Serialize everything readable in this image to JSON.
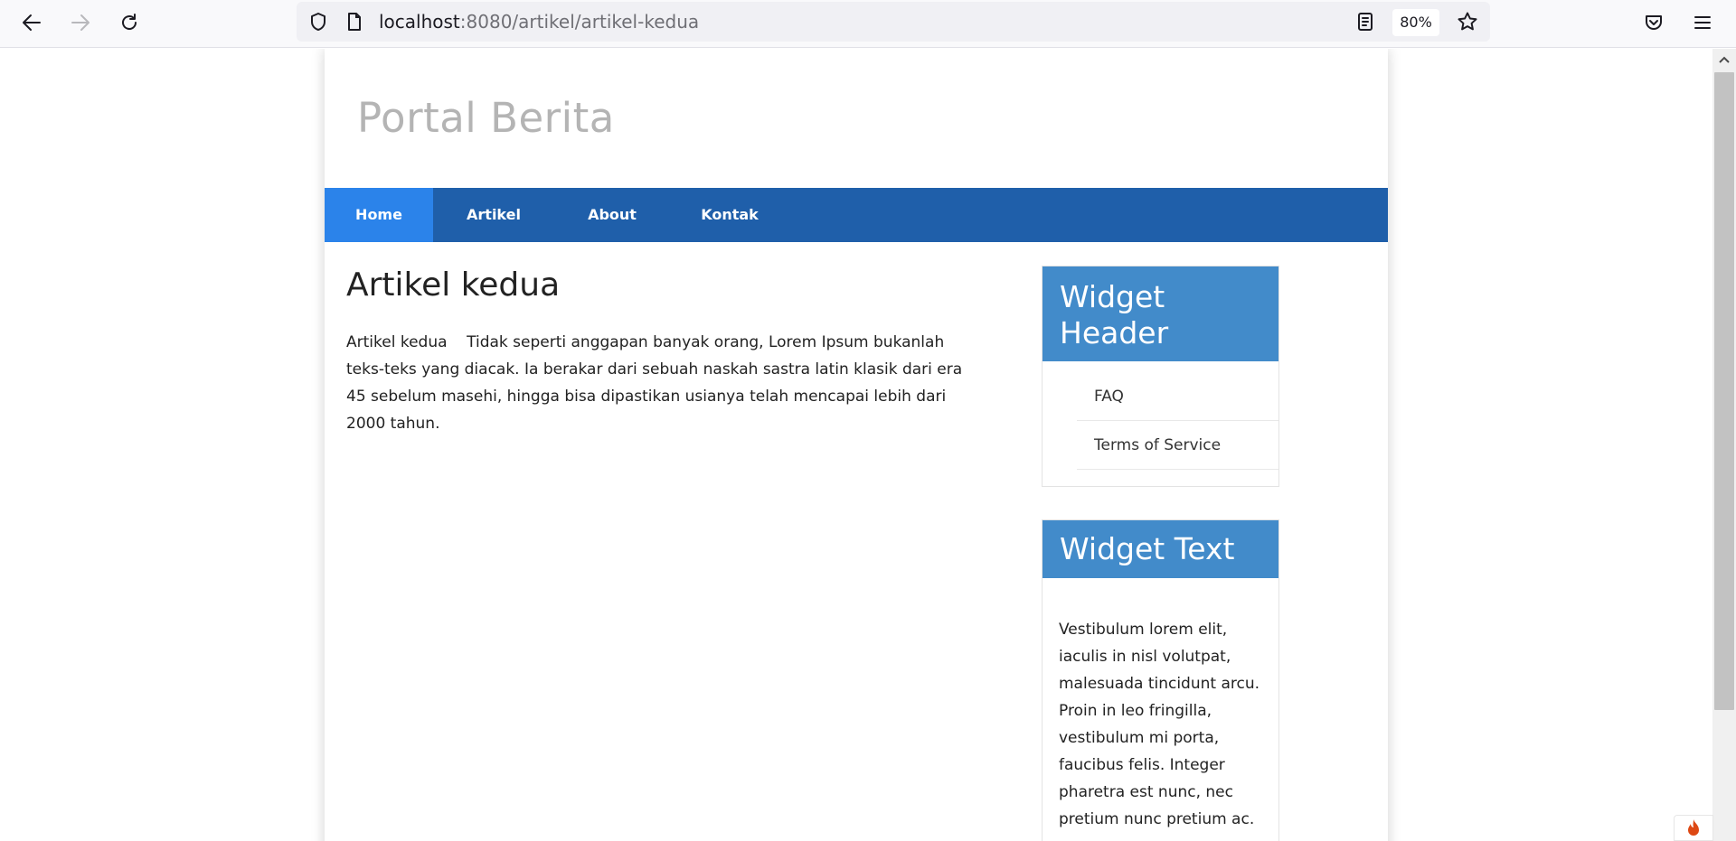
{
  "browser": {
    "url_host": "localhost",
    "url_rest": ":8080/artikel/artikel-kedua",
    "zoom": "80%"
  },
  "site": {
    "title": "Portal Berita"
  },
  "nav": {
    "items": [
      {
        "label": "Home"
      },
      {
        "label": "Artikel"
      },
      {
        "label": "About"
      },
      {
        "label": "Kontak"
      }
    ],
    "active_color": "#2b83ea",
    "bar_color": "#1f5faa"
  },
  "article": {
    "title": "Artikel kedua",
    "body": "Artikel kedua    Tidak seperti anggapan banyak orang, Lorem Ipsum bukanlah teks-teks yang diacak. Ia berakar dari sebuah naskah sastra latin klasik dari era 45 sebelum masehi, hingga bisa dipastikan usianya telah mencapai lebih dari 2000 tahun."
  },
  "sidebar": {
    "widget_header": {
      "title": "Widget Header",
      "links": [
        {
          "label": "FAQ"
        },
        {
          "label": "Terms of Service"
        }
      ]
    },
    "widget_text": {
      "title": "Widget Text",
      "body": "Vestibulum lorem elit, iaculis in nisl volutpat, malesuada tincidunt arcu. Proin in leo fringilla, vestibulum mi porta, faucibus felis. Integer pharetra est nunc, nec pretium nunc pretium ac."
    },
    "accent_color": "#428bca"
  }
}
